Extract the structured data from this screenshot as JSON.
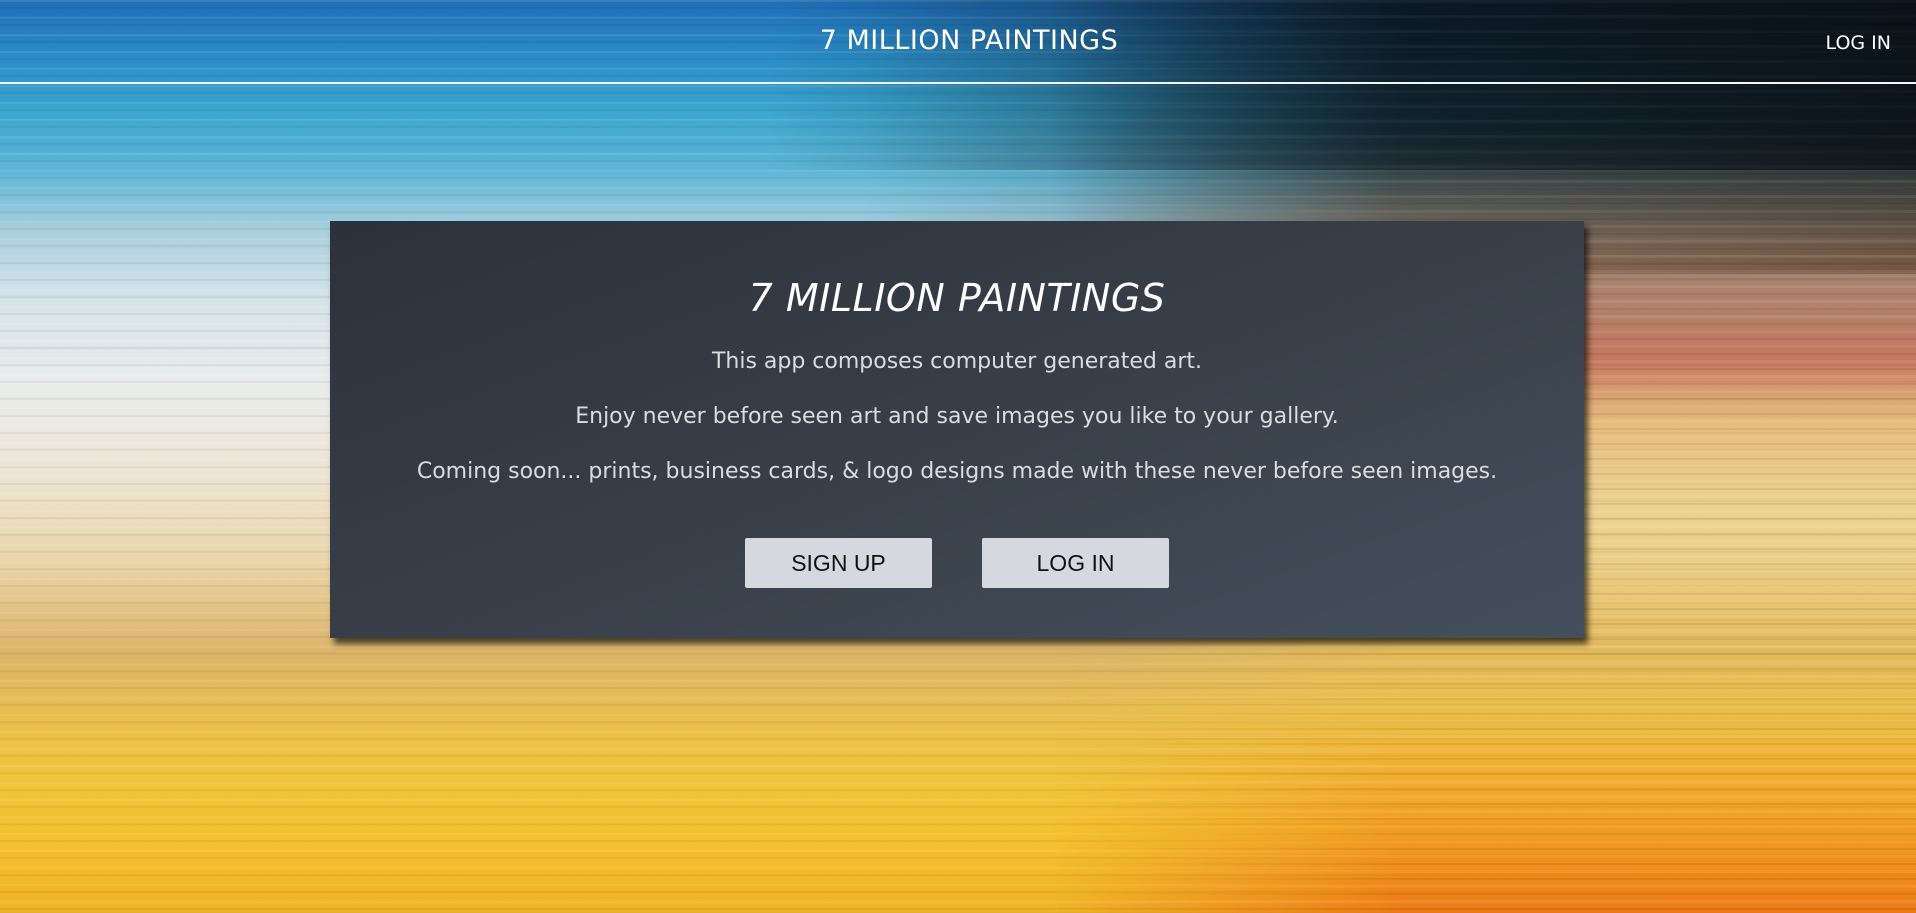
{
  "header": {
    "brand": "7 MILLION PAINTINGS",
    "login_label": "LOG IN"
  },
  "hero": {
    "title": "7 MILLION PAINTINGS",
    "lines": [
      "This app composes computer generated art.",
      "Enjoy never before seen art and save images you like to your gallery.",
      "Coming soon... prints, business cards, & logo designs made with these never before seen images."
    ],
    "signup_label": "SIGN UP",
    "login_label": "LOG IN"
  },
  "colors": {
    "card_background": "#383f49",
    "button_background": "#d5d8de",
    "header_rule": "#f2f4f6"
  }
}
